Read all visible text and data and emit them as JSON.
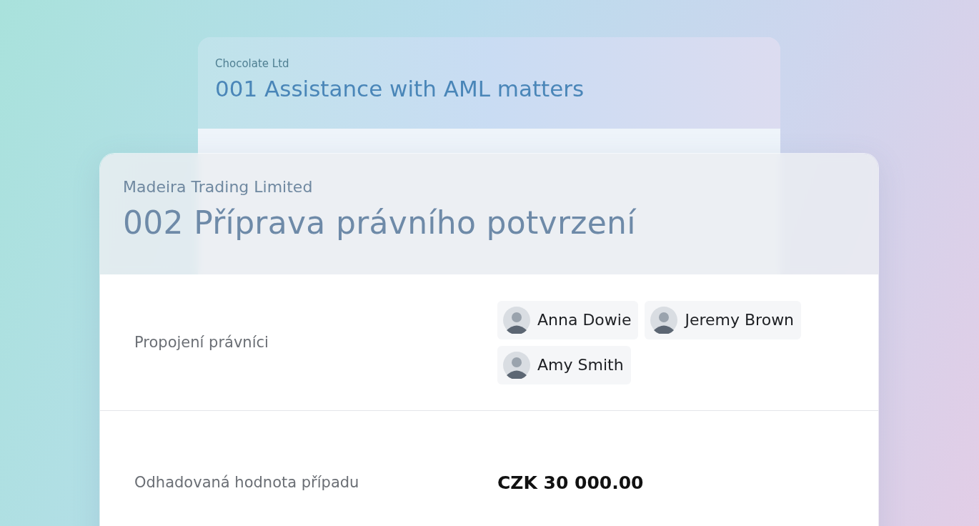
{
  "back_card": {
    "client": "Chocolate Ltd",
    "title": "001 Assistance with AML matters"
  },
  "case_card": {
    "client": "Madeira Trading Limited",
    "title": "002 Příprava právního potvrzení",
    "rows": [
      {
        "kind": "people",
        "label": "Propojení právníci",
        "people": [
          {
            "name": "Anna Dowie"
          },
          {
            "name": "Jeremy Brown"
          },
          {
            "name": "Amy Smith"
          }
        ]
      },
      {
        "kind": "value",
        "label": "Odhadovaná hodnota případu",
        "value": "CZK 30 000.00"
      }
    ]
  }
}
